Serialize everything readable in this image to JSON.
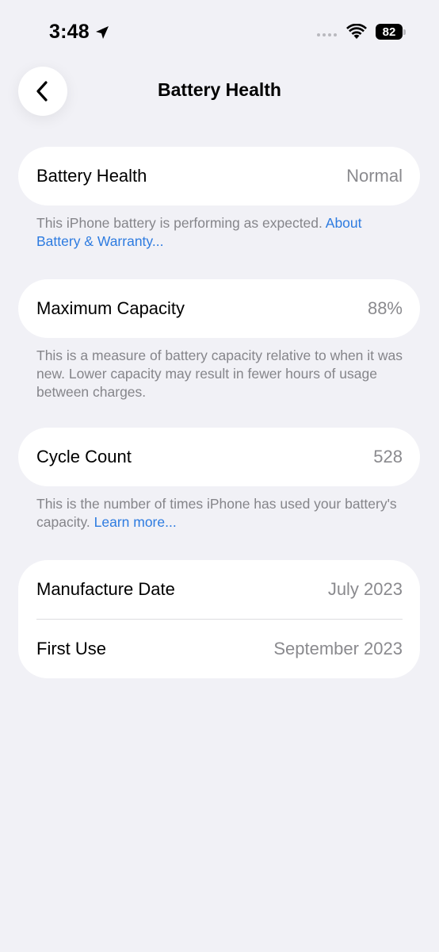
{
  "status_bar": {
    "time": "3:48",
    "battery_level": "82"
  },
  "nav": {
    "title": "Battery Health"
  },
  "sections": {
    "health": {
      "label": "Battery Health",
      "value": "Normal",
      "footnote": "This iPhone battery is performing as expected. ",
      "link": "About Battery & Warranty..."
    },
    "capacity": {
      "label": "Maximum Capacity",
      "value": "88%",
      "footnote": "This is a measure of battery capacity relative to when it was new. Lower capacity may result in fewer hours of usage between charges."
    },
    "cycles": {
      "label": "Cycle Count",
      "value": "528",
      "footnote": "This is the number of times iPhone has used your battery's capacity. ",
      "link": "Learn more..."
    },
    "dates": {
      "manufacture_label": "Manufacture Date",
      "manufacture_value": "July 2023",
      "first_use_label": "First Use",
      "first_use_value": "September 2023"
    }
  },
  "colors": {
    "background": "#f1f1f6",
    "card": "#ffffff",
    "link": "#2d7be0",
    "secondary_text": "#8a8a8e"
  }
}
